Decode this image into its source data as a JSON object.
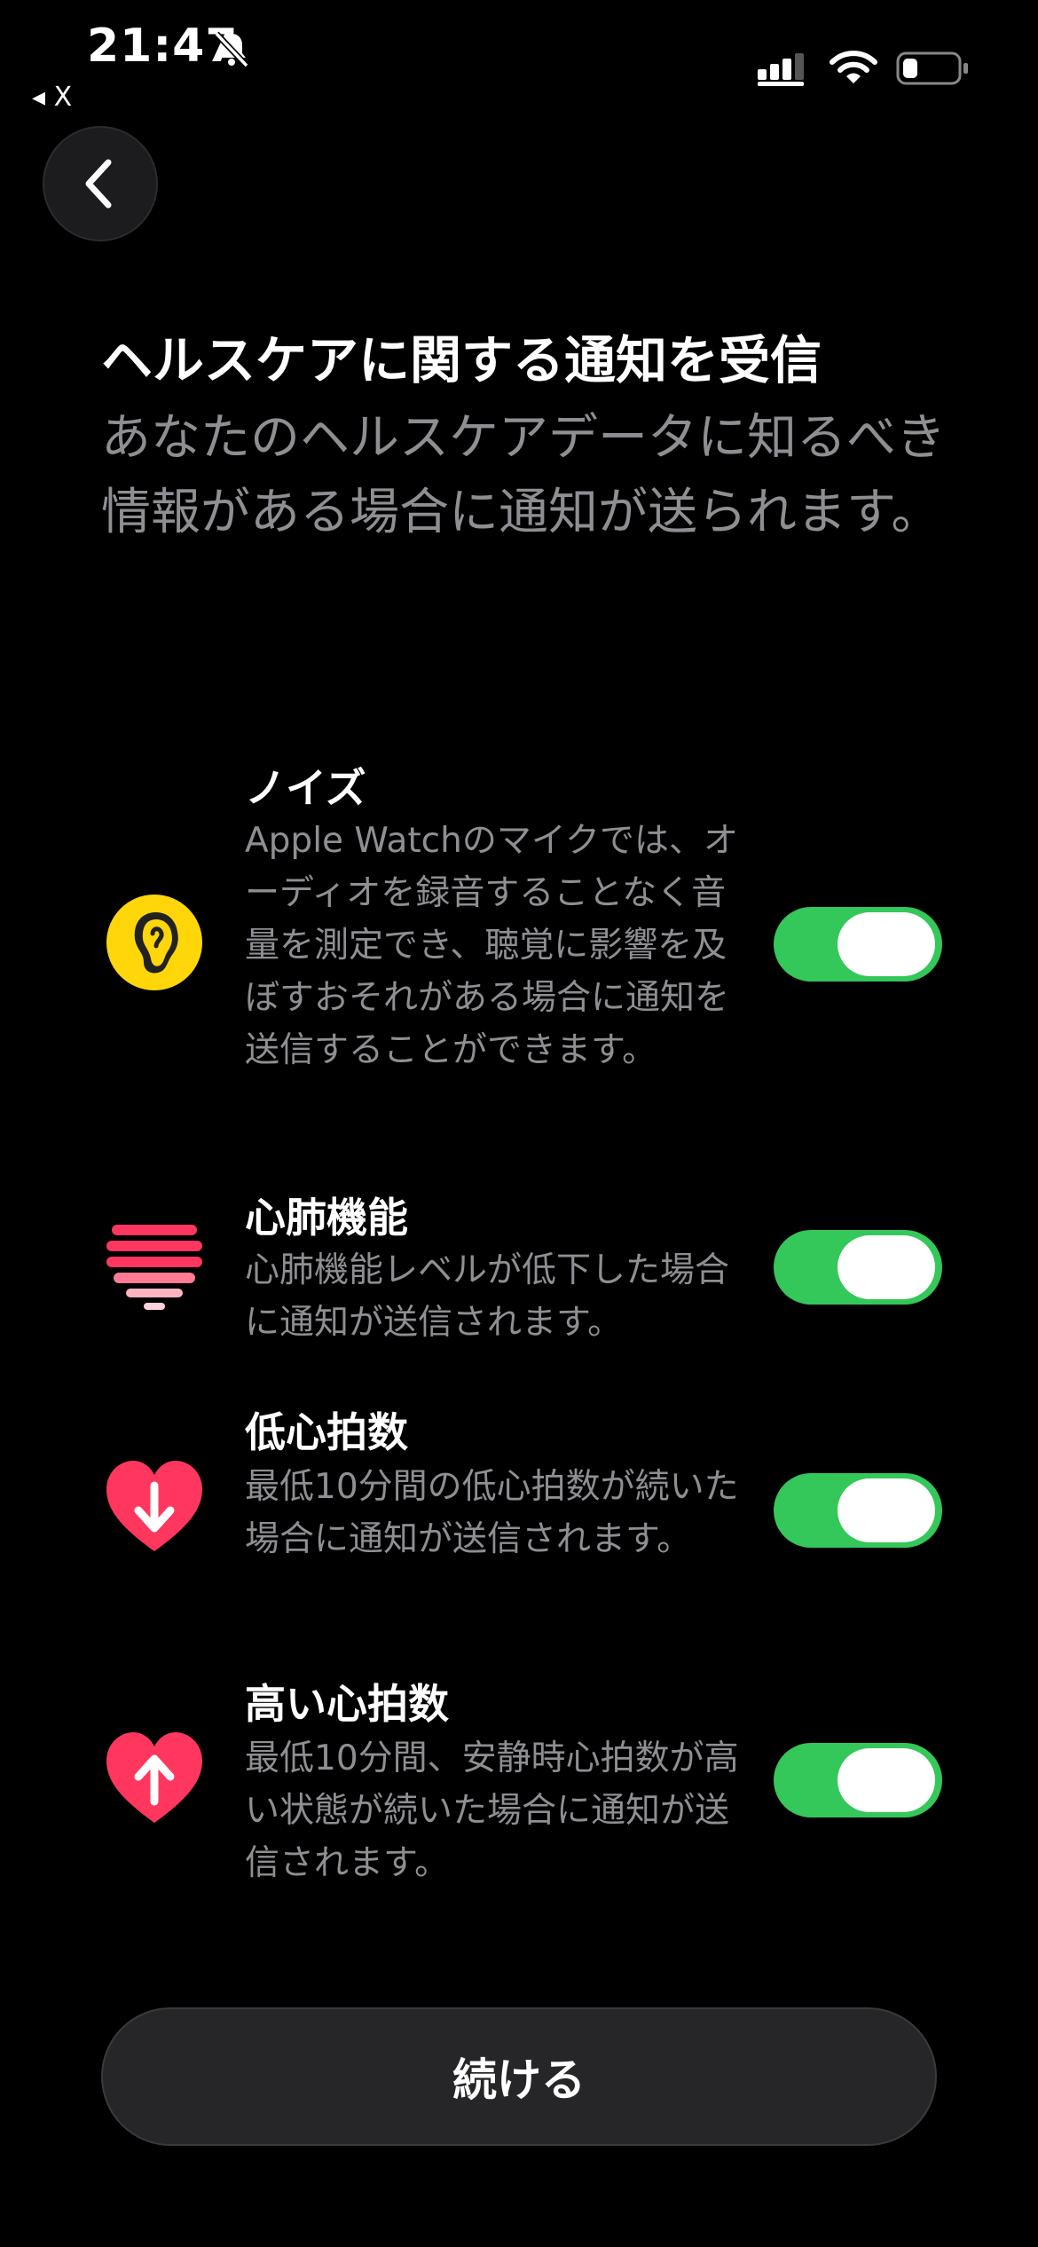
{
  "status_bar": {
    "time": "21:47",
    "back_to_app": "◂ X",
    "battery_level": 0.2
  },
  "header": {
    "title": "ヘルスケアに関する通知を受信",
    "subtitle": "あなたのヘルスケアデータに知るべき情報がある場合に通知が送られます。"
  },
  "notifications": [
    {
      "title": "ノイズ",
      "description": "Apple Watchのマイクでは、オーディオを録音することなく音量を測定でき、聴覚に影響を及ぼすおそれがある場合に通知を送信することができます。",
      "icon": "ear-icon",
      "enabled": true
    },
    {
      "title": "心肺機能",
      "description": "心肺機能レベルが低下した場合に通知が送信されます。",
      "icon": "cardio-fitness-heart-icon",
      "enabled": true
    },
    {
      "title": "低心拍数",
      "description": "最低10分間の低心拍数が続いた場合に通知が送信されます。",
      "icon": "heart-arrow-down-icon",
      "enabled": true
    },
    {
      "title": "高い心拍数",
      "description": "最低10分間、安静時心拍数が高い状態が続いた場合に通知が送信されます。",
      "icon": "heart-arrow-up-icon",
      "enabled": true
    }
  ],
  "footer": {
    "continue_label": "続ける"
  },
  "colors": {
    "background": "#000000",
    "toggle_on": "#34c759",
    "secondary_text": "#8e8e93",
    "noise_yellow": "#ffd60a",
    "heart_pink": "#ff375f"
  }
}
